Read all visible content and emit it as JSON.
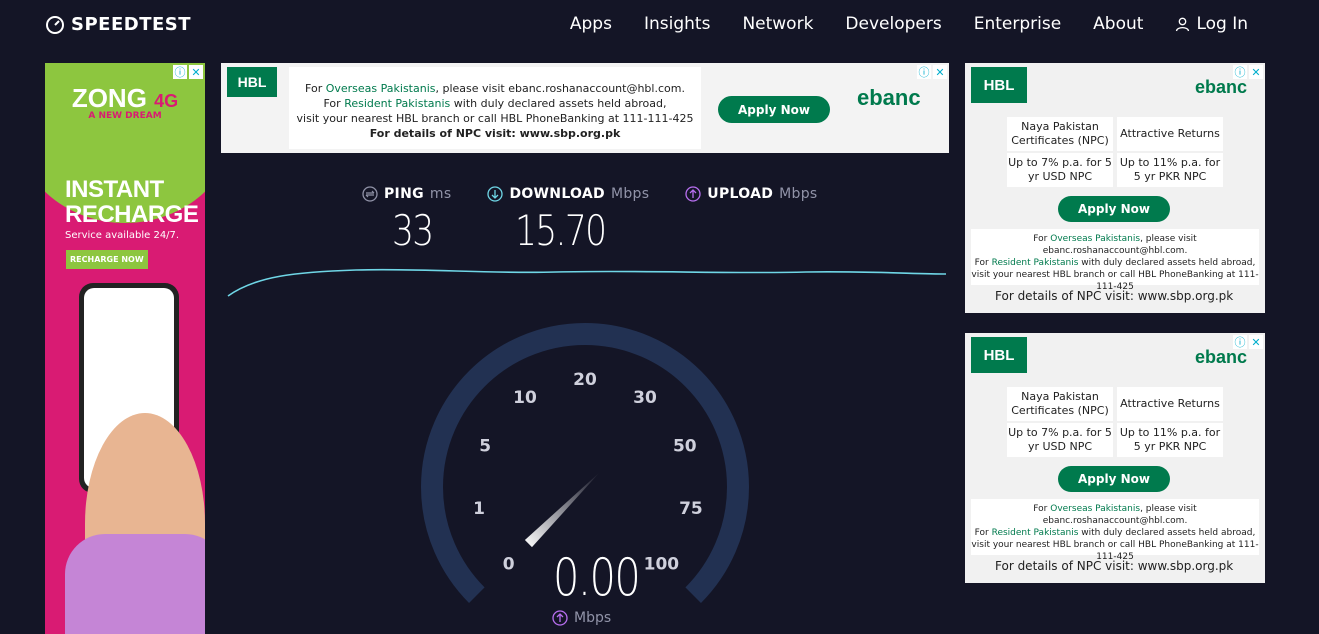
{
  "header": {
    "brand": "SPEEDTEST",
    "nav": [
      "Apps",
      "Insights",
      "Network",
      "Developers",
      "Enterprise",
      "About"
    ],
    "login_label": "Log In"
  },
  "ad_left": {
    "brand": "ZONG",
    "brand_suffix": "4G",
    "tagline": "A NEW DREAM",
    "headline_1": "INSTANT",
    "headline_2": "RECHARGE",
    "service": "Service available 24/7.",
    "cta": "RECHARGE NOW"
  },
  "ad_top": {
    "logo": "HBL",
    "line1_pre": "For ",
    "line1_link": "Overseas Pakistanis",
    "line1_post": ", please visit ebanc.roshanaccount@hbl.com.",
    "line2_pre": "For ",
    "line2_link": "Resident Pakistanis",
    "line2_post": " with duly  declared assets held abroad,",
    "line3": "visit your nearest HBL branch or call HBL PhoneBanking at 111-111-425",
    "line4": "For details of NPC visit: www.sbp.org.pk",
    "cta": "Apply Now",
    "product": "ebanc"
  },
  "ad_side": {
    "logo": "HBL",
    "product": "ebanc",
    "cell1": "Naya Pakistan Certificates (NPC)",
    "cell2": "Attractive Returns",
    "cell3": "Up to 7% p.a. for 5 yr USD NPC",
    "cell4": "Up to 11% p.a. for 5 yr PKR NPC",
    "cta": "Apply Now",
    "small1_pre": "For ",
    "small1_link": "Overseas Pakistanis",
    "small1_post": ", please visit ebanc.roshanaccount@hbl.com.",
    "small2_pre": "For ",
    "small2_link": "Resident Pakistanis",
    "small2_post": " with duly declared assets held abroad,",
    "small3": "visit your nearest HBL branch or call HBL PhoneBanking at 111-111-425",
    "npc": "For details of NPC visit: www.sbp.org.pk"
  },
  "test": {
    "ping_label": "PING",
    "ping_unit": "ms",
    "ping_value": "33",
    "download_label": "DOWNLOAD",
    "download_unit": "Mbps",
    "download_value": "15.70",
    "upload_label": "UPLOAD",
    "upload_unit": "Mbps",
    "upload_value": "",
    "current_speed": "0.00",
    "current_unit": "Mbps",
    "gauge_ticks": [
      "0",
      "1",
      "5",
      "10",
      "20",
      "30",
      "50",
      "75",
      "100"
    ],
    "needle_fraction": 0.0
  },
  "colors": {
    "background": "#141526",
    "accent_cyan": "#6fd6e6",
    "accent_purple": "#b86ff0",
    "gauge_track": "#223152",
    "hbl_green": "#007a4d",
    "zong_pink": "#d91b73"
  }
}
